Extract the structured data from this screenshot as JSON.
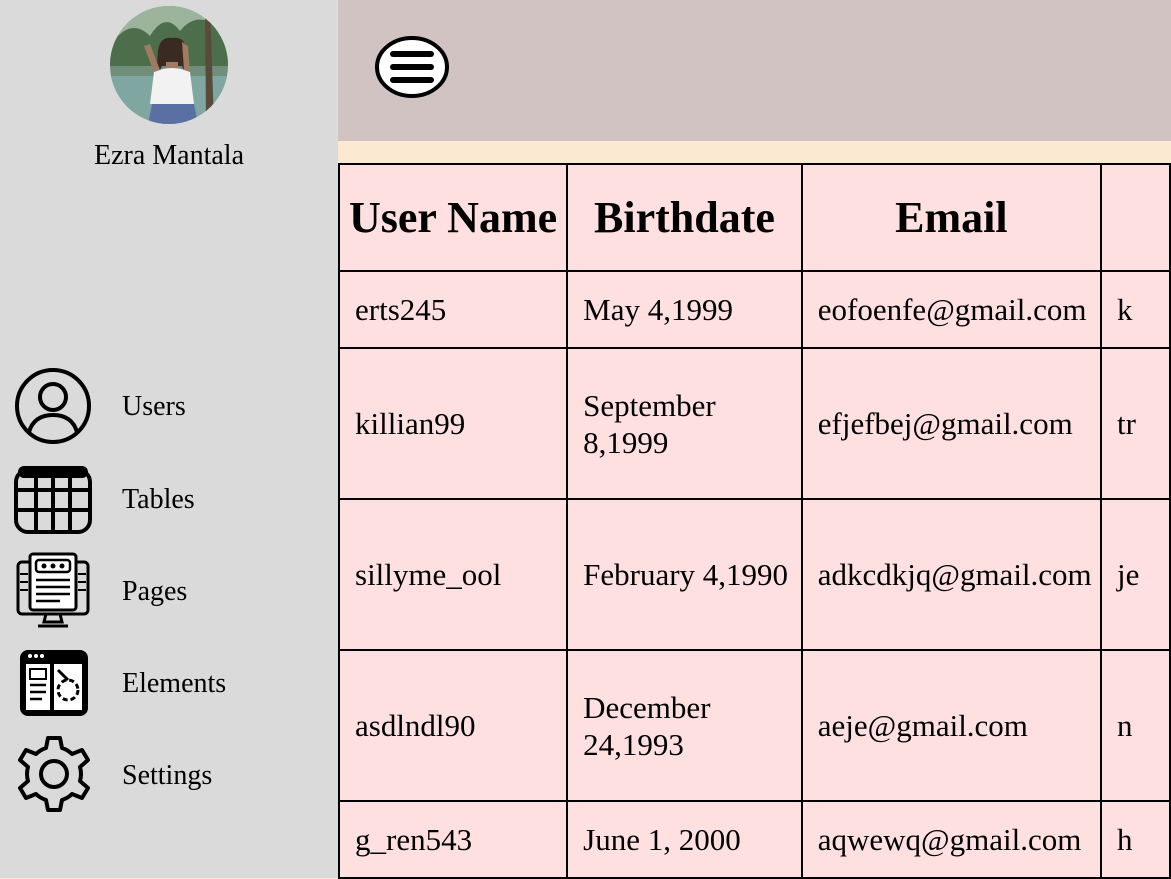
{
  "profile": {
    "name": "Ezra Mantala"
  },
  "nav": {
    "items": [
      {
        "label": "Users",
        "icon": "user-icon"
      },
      {
        "label": "Tables",
        "icon": "table-icon"
      },
      {
        "label": "Pages",
        "icon": "pages-icon"
      },
      {
        "label": "Elements",
        "icon": "elements-icon"
      },
      {
        "label": "Settings",
        "icon": "gear-icon"
      }
    ]
  },
  "header": {
    "menu_icon": "hamburger-menu-icon"
  },
  "table": {
    "columns": [
      "User Name",
      "Birthdate",
      "Email",
      ""
    ],
    "rows": [
      {
        "username": "erts245",
        "birthdate": "May 4,1999",
        "email": "eofoenfe@gmail.com",
        "extra": "k"
      },
      {
        "username": "killian99",
        "birthdate": "September 8,1999",
        "email": "efjefbej@gmail.com",
        "extra": "tr"
      },
      {
        "username": "sillyme_ool",
        "birthdate": "February 4,1990",
        "email": "adkcdkjq@gmail.com",
        "extra": "je"
      },
      {
        "username": "asdlndl90",
        "birthdate": "December 24,1993",
        "email": "aeje@gmail.com",
        "extra": "n"
      },
      {
        "username": "g_ren543",
        "birthdate": "June 1, 2000",
        "email": "aqwewq@gmail.com",
        "extra": "h"
      }
    ]
  },
  "colors": {
    "sidebar_bg": "#dadada",
    "topbar_bg": "#d2c3c3",
    "strip_bg": "#fbe9d2",
    "table_bg": "#ffe0e0"
  }
}
